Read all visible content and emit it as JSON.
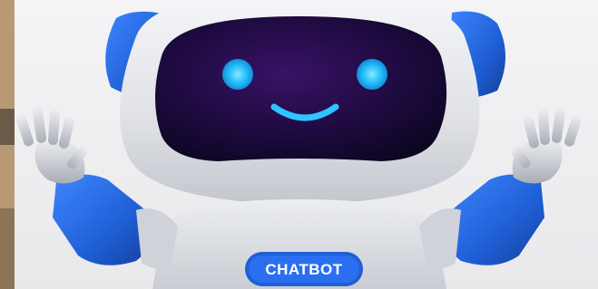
{
  "image": {
    "subject": "robot-mascot",
    "badge_text": "CHATBOT"
  },
  "colors": {
    "background": "#f1f1f3",
    "robot_body": "#e4e5e9",
    "robot_accent_blue": "#1f5fd6",
    "visor": "#1a0b3a",
    "eye_glow": "#2ec4ff"
  },
  "icons": [
    "robot-mascot",
    "waving-hand-left",
    "waving-hand-right"
  ]
}
